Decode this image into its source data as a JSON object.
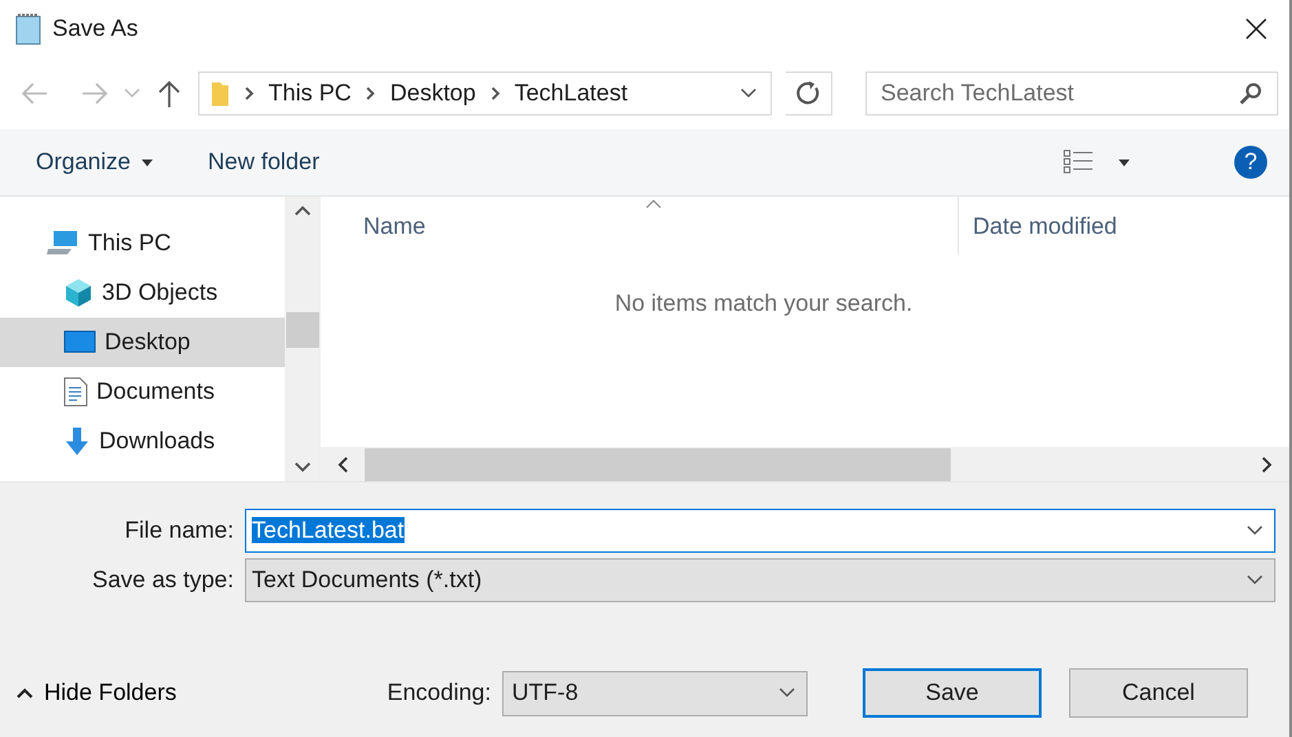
{
  "window": {
    "title": "Save As"
  },
  "address_bar": {
    "path": [
      "This PC",
      "Desktop",
      "TechLatest"
    ]
  },
  "search": {
    "placeholder": "Search TechLatest"
  },
  "toolbar": {
    "organize": "Organize",
    "new_folder": "New folder",
    "help": "?"
  },
  "sidebar": {
    "items": [
      {
        "label": "This PC",
        "kind": "pc",
        "selected": false,
        "children": [
          {
            "label": "3D Objects",
            "kind": "cube",
            "selected": false
          },
          {
            "label": "Desktop",
            "kind": "desktop",
            "selected": true
          },
          {
            "label": "Documents",
            "kind": "document",
            "selected": false
          },
          {
            "label": "Downloads",
            "kind": "download",
            "selected": false
          }
        ]
      }
    ]
  },
  "file_list": {
    "columns": [
      "Name",
      "Date modified"
    ],
    "empty_message": "No items match your search."
  },
  "form": {
    "file_name": {
      "label": "File name:",
      "value": "TechLatest.bat",
      "value_selected": true
    },
    "save_as_type": {
      "label": "Save as type:",
      "value": "Text Documents (*.txt)"
    }
  },
  "footer": {
    "hide_folders": "Hide Folders",
    "encoding": {
      "label": "Encoding:",
      "value": "UTF-8"
    },
    "buttons": [
      {
        "label": "Save",
        "default": true
      },
      {
        "label": "Cancel",
        "default": false
      }
    ]
  }
}
